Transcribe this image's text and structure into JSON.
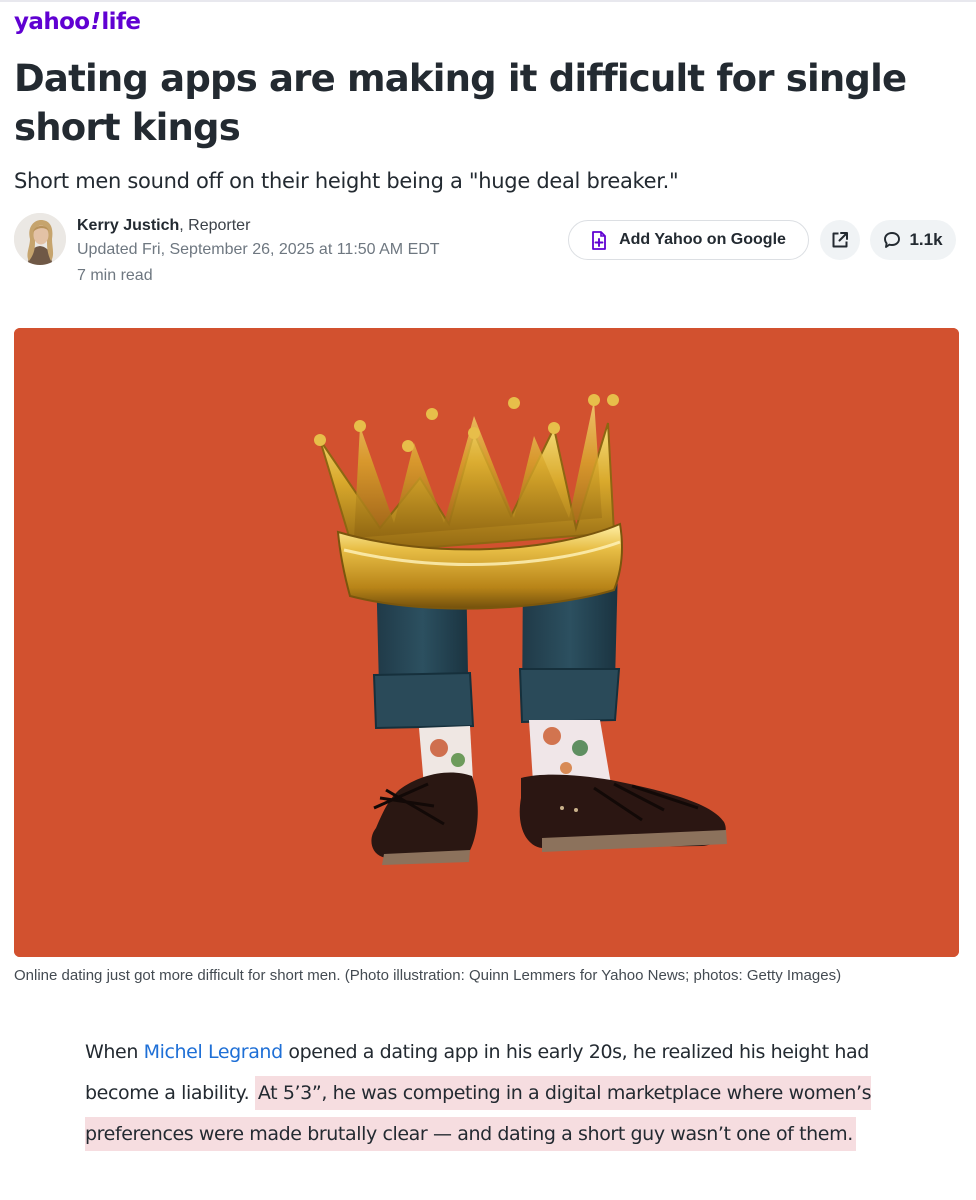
{
  "brand": {
    "name": "yahoo",
    "bang": "!",
    "section": "life"
  },
  "article": {
    "headline": "Dating apps are making it difficult for single short kings",
    "dek": "Short men sound off on their height being a \"huge deal breaker.\"",
    "author": "Kerry Justich",
    "author_suffix": ", Reporter",
    "updated": "Updated Fri, September 26, 2025 at 11:50 AM EDT",
    "read_time": "7 min read"
  },
  "actions": {
    "add_google_label": "Add Yahoo on Google",
    "comment_count": "1.1k"
  },
  "hero": {
    "caption": "Online dating just got more difficult for short men. (Photo illustration: Quinn Lemmers for Yahoo News; photos: Getty Images)"
  },
  "body": {
    "p1_intro": "When ",
    "p1_link": "Michel Legrand",
    "p1_mid": " opened a dating app in his early 20s, he realized his height had become a liability. ",
    "p1_highlight": "At 5’3”, he was competing in a digital marketplace where women’s preferences were made brutally clear — and dating a short guy wasn’t one of them."
  },
  "colors": {
    "brand_purple": "#6001d2",
    "hero_background": "#d2512f",
    "link_blue": "#1e6fd6",
    "highlight_pink": "#f6dde0"
  },
  "icons": {
    "google_add": "add-document-icon",
    "share": "external-link-icon",
    "comments": "speech-bubble-icon"
  }
}
